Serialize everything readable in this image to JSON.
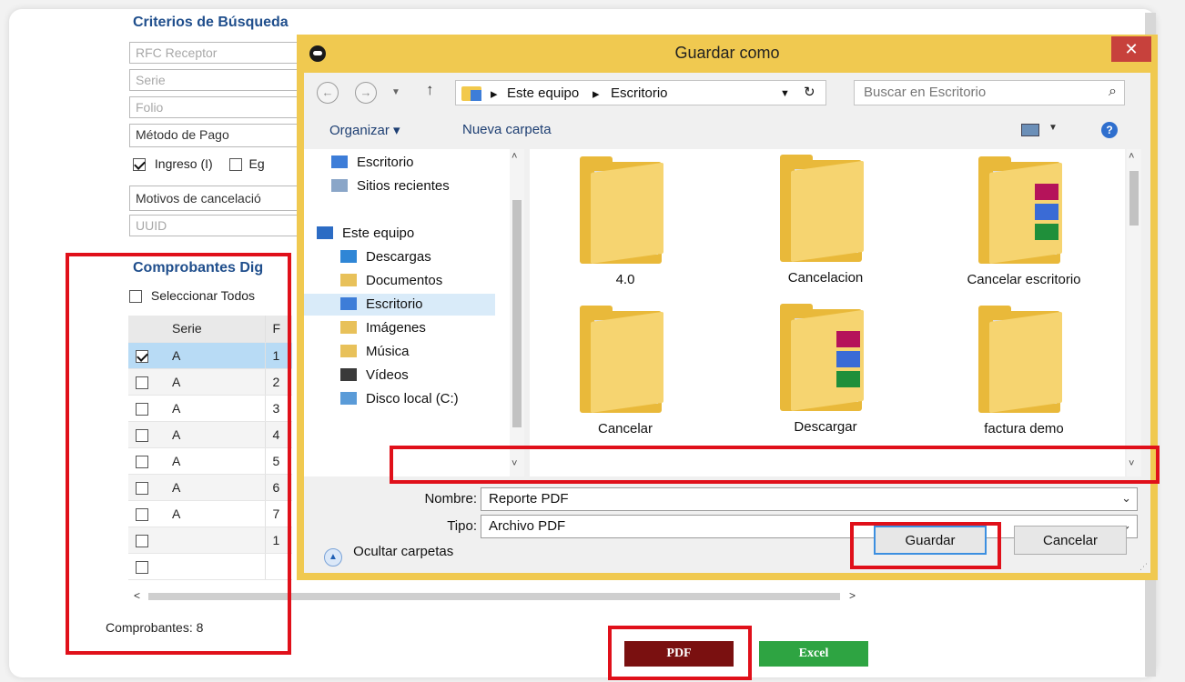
{
  "form": {
    "criteria_title": "Criterios de Búsqueda",
    "rfc_placeholder": "RFC Receptor",
    "serie_placeholder": "Serie",
    "folio_placeholder": "Folio",
    "metodo_pago": "Método de Pago",
    "ingreso_label": "Ingreso (I)",
    "egreso_label_fragment": "Eg",
    "motivos": "Motivos de cancelació",
    "uuid_placeholder": "UUID",
    "comprobantes_title": "Comprobantes Dig",
    "select_all_label": "Seleccionar Todos",
    "grid_headers": [
      "",
      "Serie",
      "F"
    ],
    "grid_rows": [
      {
        "checked": true,
        "serie": "A",
        "f": "1"
      },
      {
        "checked": false,
        "serie": "A",
        "f": "2"
      },
      {
        "checked": false,
        "serie": "A",
        "f": "3"
      },
      {
        "checked": false,
        "serie": "A",
        "f": "4"
      },
      {
        "checked": false,
        "serie": "A",
        "f": "5"
      },
      {
        "checked": false,
        "serie": "A",
        "f": "6"
      },
      {
        "checked": false,
        "serie": "A",
        "f": "7"
      },
      {
        "checked": false,
        "serie": "",
        "f": "1"
      },
      {
        "checked": false,
        "serie": "",
        "f": ""
      }
    ],
    "count_label": "Comprobantes: 8",
    "pdf_button": "PDF",
    "excel_button": "Excel"
  },
  "dialog": {
    "title": "Guardar como",
    "close": "✕",
    "nav_back": "←",
    "nav_forward": "→",
    "nav_up": "↑",
    "breadcrumb_sep": "▸",
    "breadcrumb": [
      "Este equipo",
      "Escritorio"
    ],
    "refresh": "↻",
    "search_placeholder": "Buscar en Escritorio",
    "organize": "Organizar ▾",
    "new_folder": "Nueva carpeta",
    "help": "?",
    "nav_pane": [
      {
        "label": "Escritorio",
        "icon": "desktop-icon"
      },
      {
        "label": "Sitios recientes",
        "icon": "recent-icon"
      },
      {
        "label": "Este equipo",
        "icon": "computer-icon"
      },
      {
        "label": "Descargas",
        "icon": "downloads-icon"
      },
      {
        "label": "Documentos",
        "icon": "documents-icon"
      },
      {
        "label": "Escritorio",
        "icon": "desktop-icon"
      },
      {
        "label": "Imágenes",
        "icon": "pictures-icon"
      },
      {
        "label": "Música",
        "icon": "music-icon"
      },
      {
        "label": "Vídeos",
        "icon": "videos-icon"
      },
      {
        "label": "Disco local (C:)",
        "icon": "drive-icon"
      }
    ],
    "files": [
      {
        "name": "4.0"
      },
      {
        "name": "Cancelacion"
      },
      {
        "name": "Cancelar escritorio"
      },
      {
        "name": "Cancelar"
      },
      {
        "name": "Descargar"
      },
      {
        "name": "factura demo"
      }
    ],
    "name_label": "Nombre:",
    "name_value": "Reporte PDF",
    "type_label": "Tipo:",
    "type_value": "Archivo PDF",
    "hide_folders": "Ocultar carpetas",
    "save_button": "Guardar",
    "cancel_button": "Cancelar"
  },
  "colors": {
    "highlight": "#e0101a",
    "dialog_frame": "#f0c950",
    "pdf_button": "#7a1010",
    "excel_button": "#2ea442"
  }
}
